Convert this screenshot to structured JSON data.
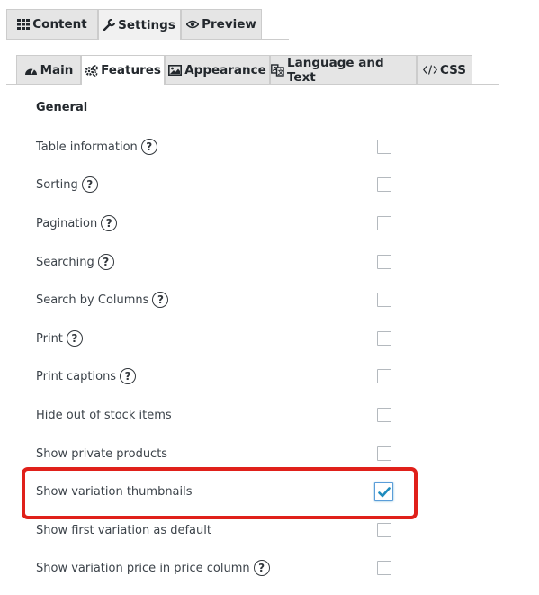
{
  "top_tabs": [
    {
      "label": "Content",
      "icon": "grid-icon"
    },
    {
      "label": "Settings",
      "icon": "wrench-icon"
    },
    {
      "label": "Preview",
      "icon": "eye-icon"
    }
  ],
  "sub_tabs": [
    {
      "label": "Main",
      "icon": "dashboard-icon"
    },
    {
      "label": "Features",
      "icon": "gears-icon"
    },
    {
      "label": "Appearance",
      "icon": "image-icon"
    },
    {
      "label": "Language and Text",
      "icon": "translate-icon"
    },
    {
      "label": "CSS",
      "icon": "code-icon"
    }
  ],
  "section": {
    "title": "General"
  },
  "options": [
    {
      "label": "Table information",
      "help": true,
      "checked": false
    },
    {
      "label": "Sorting",
      "help": true,
      "checked": false
    },
    {
      "label": "Pagination",
      "help": true,
      "checked": false
    },
    {
      "label": "Searching",
      "help": true,
      "checked": false
    },
    {
      "label": "Search by Columns",
      "help": true,
      "checked": false
    },
    {
      "label": "Print",
      "help": true,
      "checked": false
    },
    {
      "label": "Print captions",
      "help": true,
      "checked": false
    },
    {
      "label": "Hide out of stock items",
      "help": false,
      "checked": false
    },
    {
      "label": "Show private products",
      "help": false,
      "checked": false
    },
    {
      "label": "Show variation thumbnails",
      "help": false,
      "checked": true
    },
    {
      "label": "Show first variation as default",
      "help": false,
      "checked": false
    },
    {
      "label": "Show variation price in price column",
      "help": true,
      "checked": false
    }
  ],
  "help_glyph": "?",
  "colors": {
    "highlight": "#e0201a",
    "check": "#1e8cbe"
  }
}
